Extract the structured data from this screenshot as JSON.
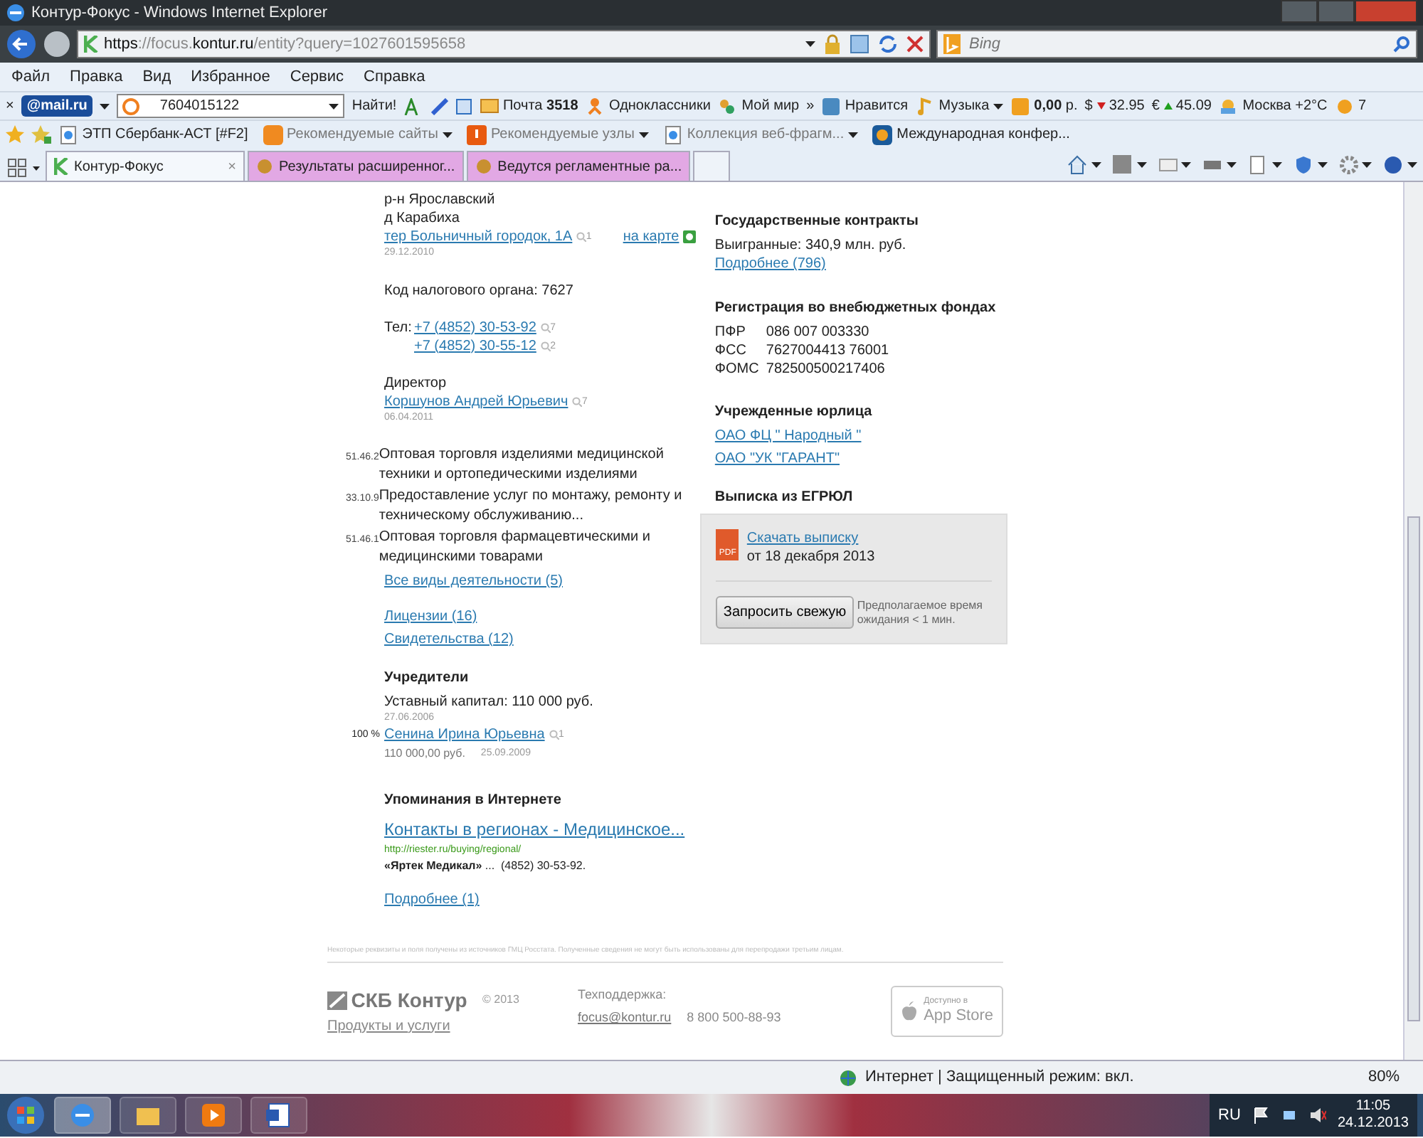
{
  "window": {
    "title": "Контур-Фокус - Windows Internet Explorer"
  },
  "address": {
    "url_prefix": "https://focus.",
    "url_domain": "kontur.ru",
    "url_rest": "/entity?query=1027601595658"
  },
  "search": {
    "placeholder": "Bing"
  },
  "menu": [
    "Файл",
    "Правка",
    "Вид",
    "Избранное",
    "Сервис",
    "Справка"
  ],
  "mail_toolbar": {
    "close": "×",
    "logo": "@mail.ru",
    "search_value": "7604015122",
    "find_label": "Найти!",
    "items": [
      {
        "kind": "mail",
        "text": "Почта **3518**"
      },
      {
        "kind": "ok",
        "text": "Одноклассники"
      },
      {
        "kind": "world",
        "text": "Мой мир"
      },
      {
        "kind": "more",
        "text": "»"
      },
      {
        "kind": "like",
        "text": "Нравится"
      },
      {
        "kind": "music",
        "text": "Музыка"
      },
      {
        "kind": "money",
        "text": "**0,00** р."
      },
      {
        "kind": "rate",
        "symbol": "$",
        "falling": true,
        "text": "32.95"
      },
      {
        "kind": "rate",
        "symbol": "€",
        "falling": false,
        "text": "45.09"
      },
      {
        "kind": "weather",
        "text": "Москва +2°C"
      },
      {
        "kind": "games",
        "text": "7"
      }
    ]
  },
  "favorites": [
    {
      "kind": "ie",
      "text": "ЭТП Сбербанк-АСТ [#F2]",
      "menu": false,
      "dim": false
    },
    {
      "kind": "bing",
      "text": "Рекомендуемые сайты",
      "menu": true,
      "dim": true
    },
    {
      "kind": "tip",
      "text": "Рекомендуемые узлы",
      "menu": true,
      "dim": true
    },
    {
      "kind": "ie",
      "text": "Коллекция веб-фрагм...",
      "menu": true,
      "dim": true
    },
    {
      "kind": "mail",
      "text": "Международная конфер...",
      "menu": false,
      "dim": false
    }
  ],
  "tab_close": "×",
  "tabs": [
    {
      "label": "Контур-Фокус",
      "selected": true
    },
    {
      "label": "Результаты расширенног...",
      "selected": false
    },
    {
      "label": "Ведутся регламентные ра...",
      "selected": false
    }
  ],
  "page": {
    "left": {
      "address_lines": [
        "р-н Ярославский",
        "д Карабиха"
      ],
      "address_link": "тер Больничный городок, 1А",
      "address_count": "1",
      "map_link": "на карте",
      "address_date": "29.12.2010",
      "tax": "Код налогового органа: 7627",
      "phone_label": "Тел:",
      "phones": [
        {
          "number": "+7 (4852) 30-53-92",
          "count": "7"
        },
        {
          "number": "+7 (4852) 30-55-12",
          "count": "2"
        }
      ],
      "director_label": "Директор",
      "director_name": "Коршунов Андрей Юрьевич",
      "director_count": "7",
      "director_date": "06.04.2011",
      "activities": [
        {
          "code": "51.46.2",
          "text": "Оптовая торговля изделиями медицинской техники и ортопедическими изделиями"
        },
        {
          "code": "33.10.9",
          "text": "Предоставление услуг по монтажу, ремонту и техническому обслуживанию..."
        },
        {
          "code": "51.46.1",
          "text": "Оптовая торговля фармацевтическими и медицинскими товарами"
        }
      ],
      "activities_link": "Все виды деятельности (5)",
      "doc_links": [
        "Лицензии (16)",
        "Свидетельства (12)"
      ],
      "founders_heading": "Учредители",
      "capital": "Уставный капитал: 110 000 руб.",
      "capital_date": "27.06.2006",
      "founders": [
        {
          "share": "100 %",
          "name": "Сенина Ирина Юрьевна",
          "count": "1",
          "amount": "110 000,00 руб.",
          "date": "25.09.2009"
        }
      ],
      "mentions_heading": "Упоминания в Интернете",
      "mentions": [
        {
          "title": "Контакты в регионах - Медицинское...",
          "url": "http://riester.ru/buying/regional/",
          "snippet": "**«Яртек Медикал»** ...  (4852) 30-53-92."
        }
      ],
      "mentions_more": "Подробнее (1)"
    },
    "right": {
      "contracts_heading": "Государственные контракты",
      "contracts_text": "Выигранные: 340,9 млн. руб.",
      "contracts_link": "Подробнее (796)",
      "funds_heading": "Регистрация во внебюджетных фондах",
      "funds": [
        {
          "label": "ПФР",
          "value": "086 007 003330"
        },
        {
          "label": "ФСС",
          "value": "7627004413 76001"
        },
        {
          "label": "ФОМС",
          "value": "782500500217406"
        }
      ],
      "subs_heading": "Учрежденные юрлица",
      "subs": [
        "ОАО ФЦ \" Народный \"",
        "ОАО \"УК \"ГАРАНТ\""
      ],
      "egrul_heading": "Выписка из ЕГРЮЛ",
      "pdf_label": "PDF",
      "download_link": "Скачать выписку",
      "download_date": "от 18 декабря 2013",
      "request_button": "Запросить свежую",
      "request_note": "Предполагаемое время ожидания < 1 мин."
    },
    "footer": {
      "note": "Некоторые реквизиты и поля получены из источников ГМЦ Росстата. Полученные сведения не могут быть использованы для перепродажи третьим лицам.",
      "brand": "СКБ Контур",
      "copyright": "© 2013",
      "products_link": "Продукты и услуги",
      "support_label": "Техподдержка:",
      "support_email": "focus@kontur.ru",
      "support_phone": "8 800 500-88-93",
      "store_small": "Доступно в",
      "store_big": "App Store"
    }
  },
  "status_bar": {
    "zone": "Интернет | Защищенный режим: вкл.",
    "zoom": "80%"
  },
  "taskbar": {
    "apps": [
      {
        "kind": "ie",
        "active": true
      },
      {
        "kind": "folder",
        "active": false
      },
      {
        "kind": "media",
        "active": false
      },
      {
        "kind": "word",
        "active": false
      }
    ],
    "lang": "RU",
    "time": "11:05",
    "date": "24.12.2013"
  }
}
